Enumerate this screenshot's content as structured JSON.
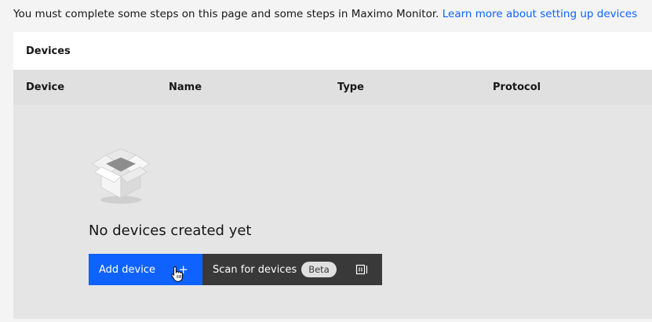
{
  "intro": {
    "text": "You must complete some steps on this page and some steps in Maximo Monitor.",
    "link": "Learn more about setting up devices"
  },
  "devices_card": {
    "title": "Devices",
    "columns": [
      "Device",
      "Name",
      "Type",
      "Protocol"
    ],
    "empty_state": {
      "icon": "open-box-icon",
      "message": "No devices created yet"
    },
    "actions": {
      "add_device_label": "Add device",
      "add_device_icon": "plus-icon",
      "scan_label": "Scan for devices",
      "scan_badge": "Beta",
      "scan_icon": "scan-icon"
    }
  },
  "colors": {
    "primary": "#0f62fe",
    "dark_button": "#393939",
    "link": "#0f62fe"
  }
}
